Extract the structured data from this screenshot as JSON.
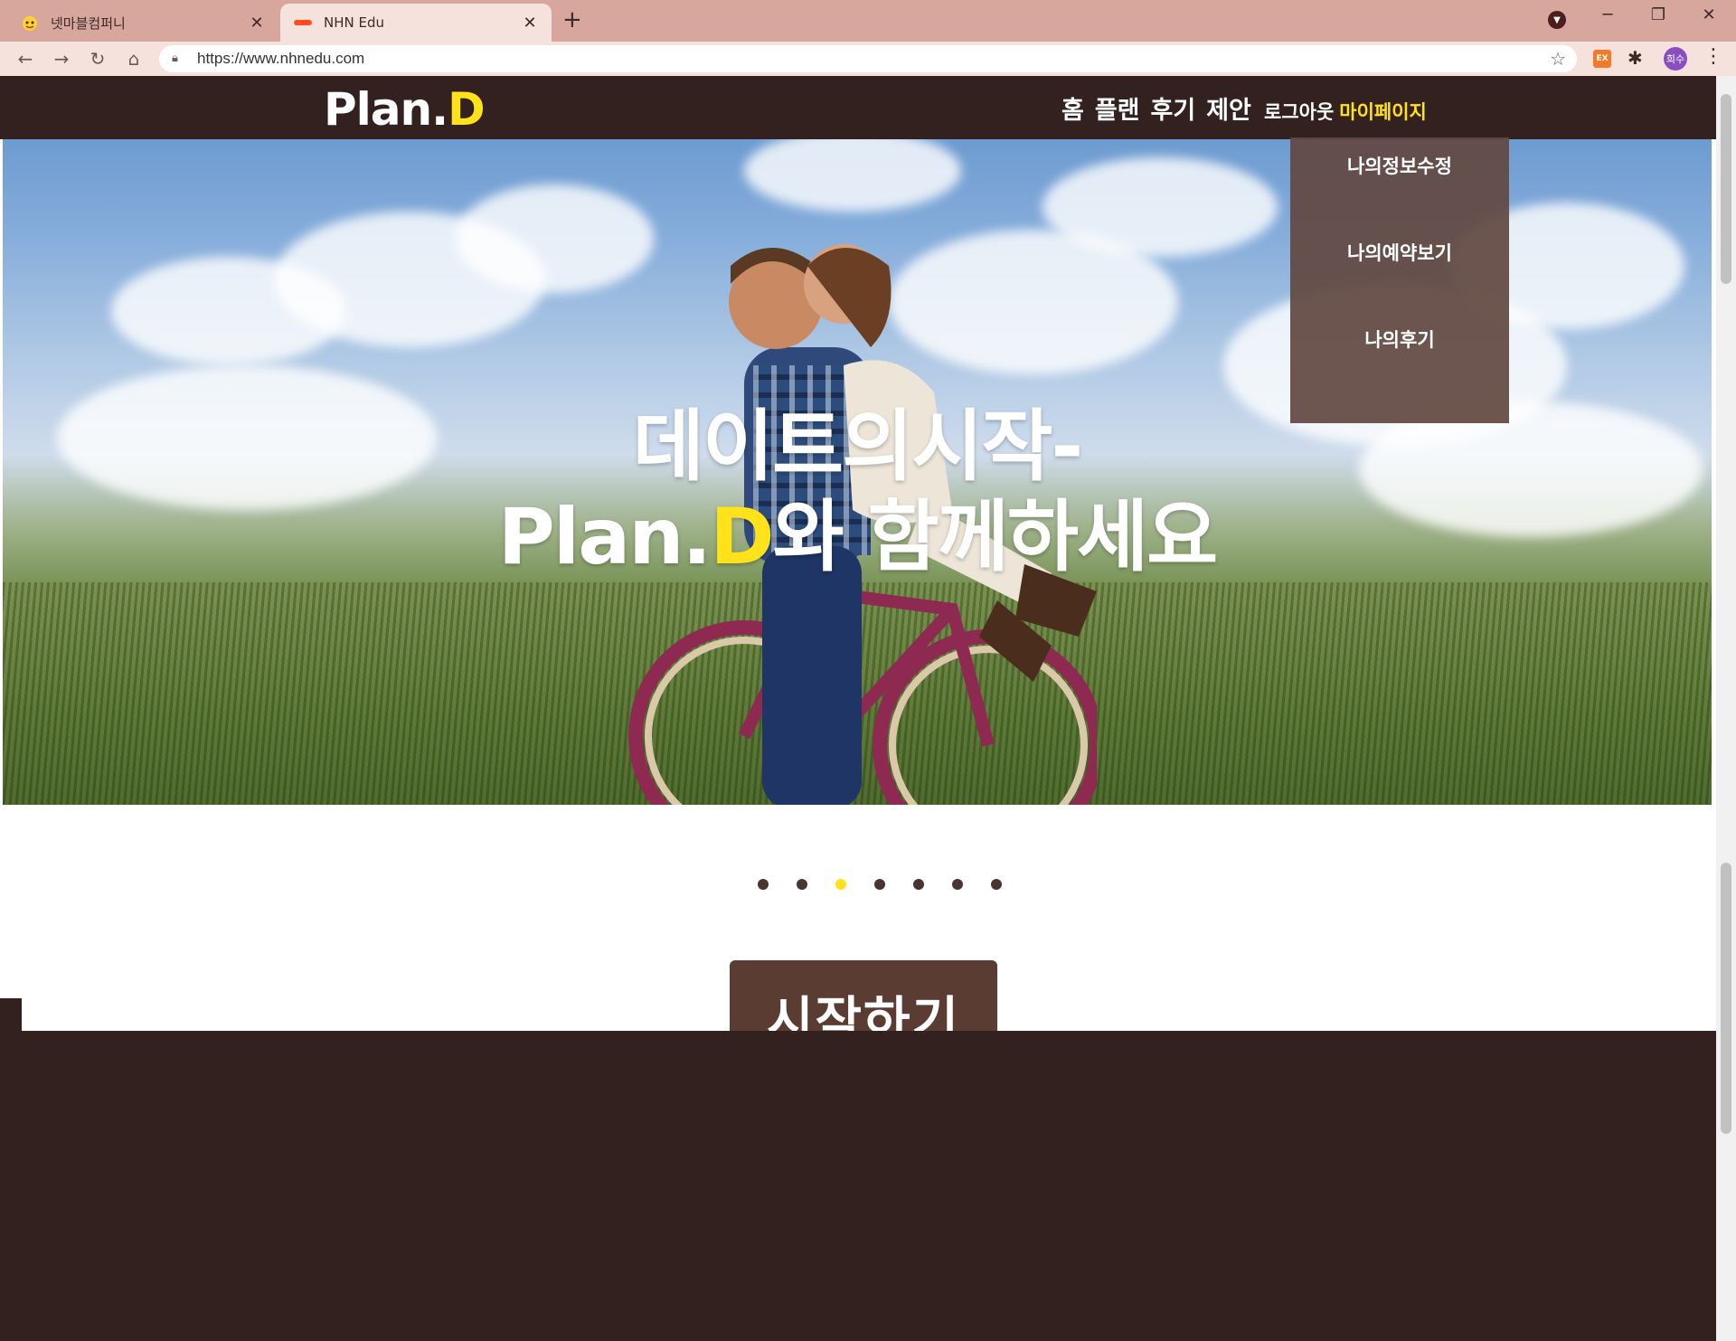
{
  "browser": {
    "tabs": [
      {
        "title": "넷마블컴퍼니",
        "active": false
      },
      {
        "title": "NHN Edu",
        "active": true
      }
    ],
    "url": "https://www.nhnedu.com",
    "profile_initials": "희수",
    "ext_label": "EX"
  },
  "site": {
    "logo_main": "Plan.",
    "logo_accent": "D",
    "nav": [
      "홈",
      "플랜",
      "후기",
      "제안"
    ],
    "logout": "로그아웃",
    "mypage": "마이페이지",
    "dropdown": [
      "나의정보수정",
      "나의예약보기",
      "나의후기"
    ],
    "hero_line1": "데이트의시작-",
    "hero_line2_a": "Plan.",
    "hero_line2_b": "D",
    "hero_line2_c": "와 함께하세요",
    "start_button": "시작하기",
    "carousel": {
      "count": 7,
      "active_index": 2
    }
  },
  "colors": {
    "brand_dark": "#32211f",
    "accent_yellow": "#ffe21a",
    "button_brown": "#5b3c33"
  }
}
